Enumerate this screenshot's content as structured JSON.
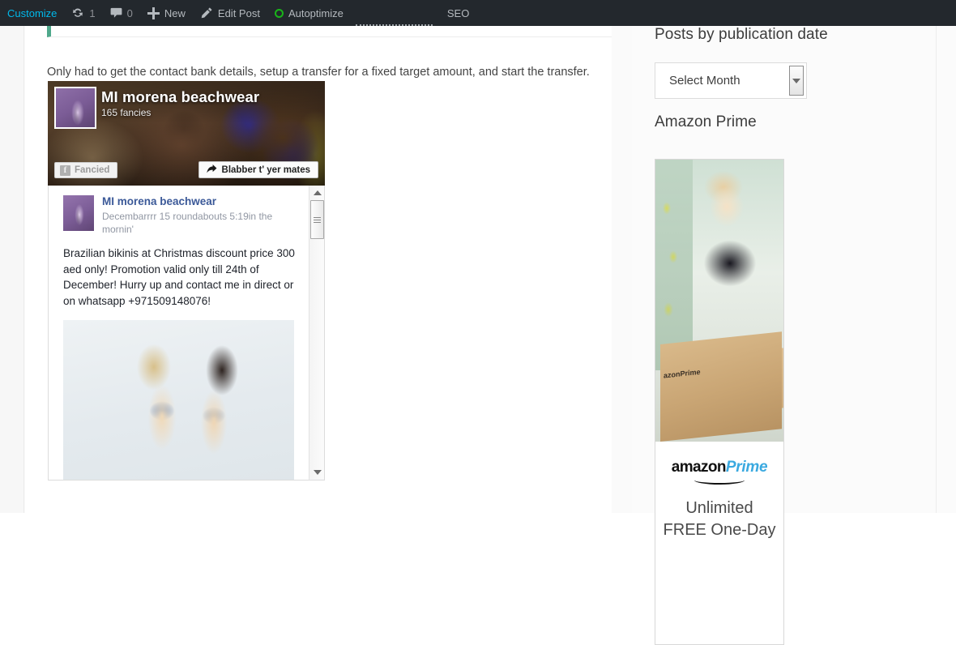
{
  "adminbar": {
    "customize": "Customize",
    "updates_count": "1",
    "comments_count": "0",
    "new_label": "New",
    "edit_post_label": "Edit Post",
    "autoptimize_label": "Autoptimize",
    "seo_label": "SEO"
  },
  "content": {
    "intro_text": "Only had to get the contact bank details, setup a transfer for a fixed target amount, and start the transfer."
  },
  "embed": {
    "page_name": "MI morena beachwear",
    "fancies": "165 fancies",
    "like_button": "Fancied",
    "share_button": "Blabber t' yer mates",
    "post": {
      "author": "MI morena beachwear",
      "timestamp": "Decembarrrr 15 roundabouts 5:19in the mornin'",
      "text": "Brazilian bikinis at Christmas discount price 300 aed only! Promotion valid only till 24th of December! Hurry up and contact me in direct or on whatsapp +971509148076!"
    }
  },
  "sidebar": {
    "archive_heading": "Posts by publication date",
    "select_month": "Select Month",
    "amazon_heading": "Amazon Prime",
    "ad": {
      "logo_primary": "amazon",
      "logo_secondary": "Prime",
      "box_label": "amazonPrime",
      "box_label2": "azonPrime",
      "tagline_line1": "Unlimited",
      "tagline_line2": "FREE One-Day"
    }
  },
  "colors": {
    "adminbar_bg": "#23282d",
    "callout_accent": "#4fa88b",
    "autoptimize_green": "#19b519",
    "fb_blue": "#3b5998",
    "amazon_blue": "#3aa9e0"
  }
}
